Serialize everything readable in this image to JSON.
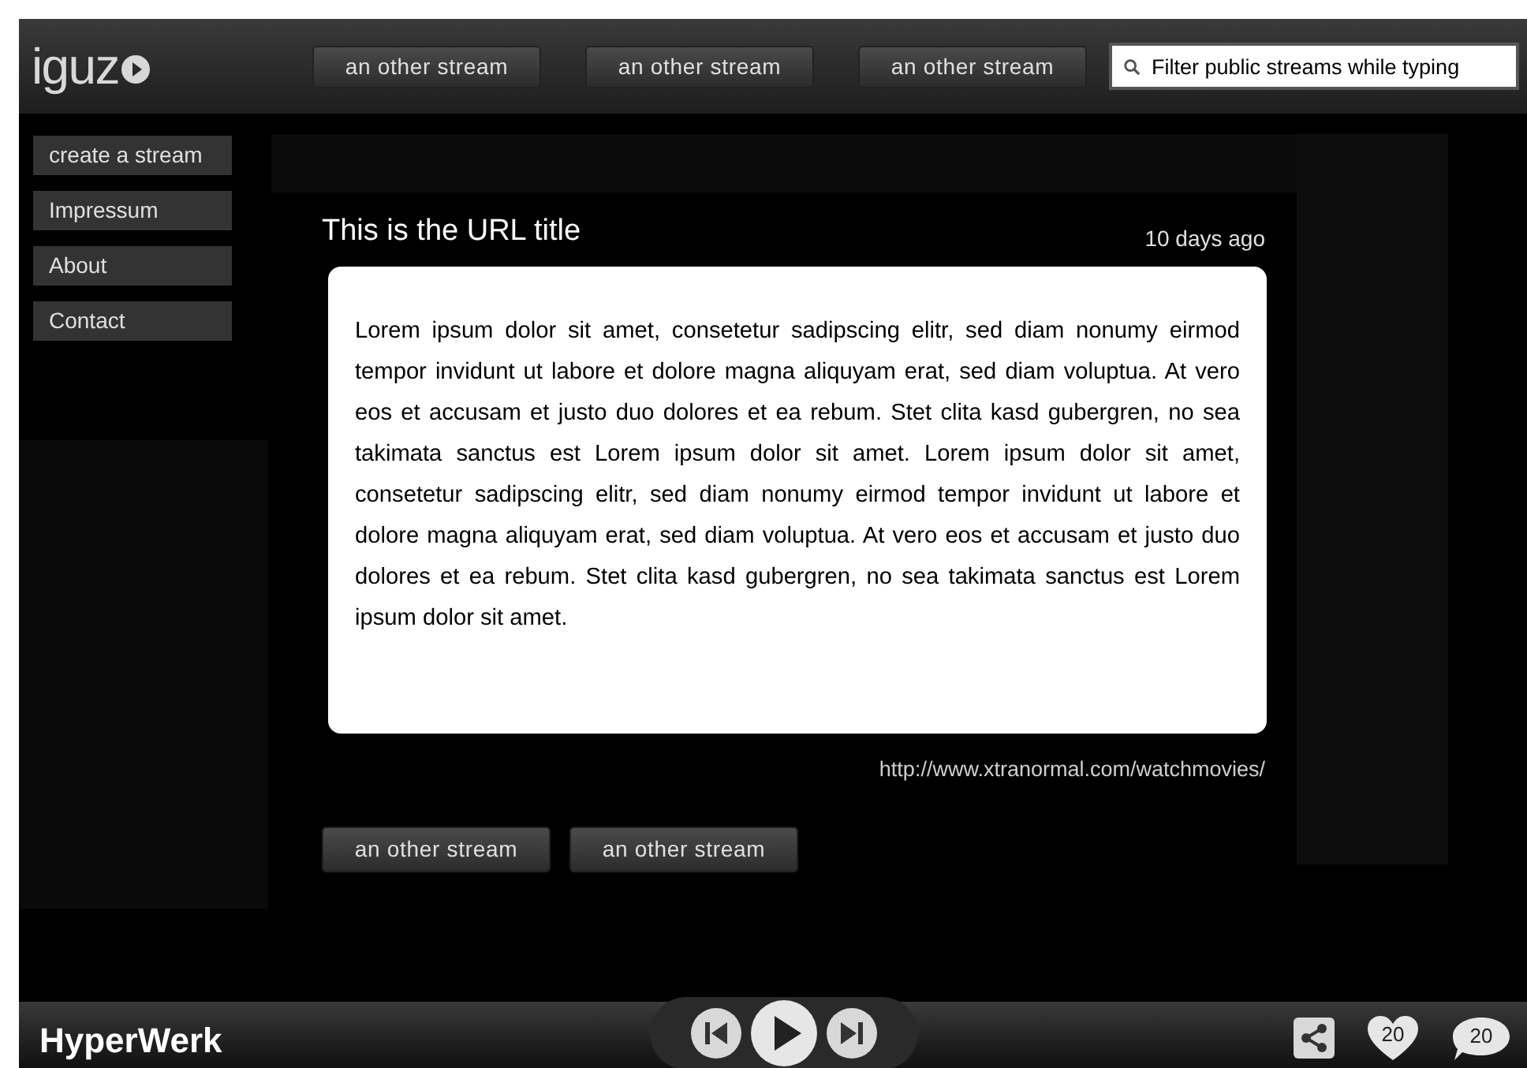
{
  "header": {
    "logo_text": "iguz",
    "stream_buttons": [
      "an other stream",
      "an other stream",
      "an other stream"
    ],
    "search": {
      "placeholder": "Filter public streams while typing"
    }
  },
  "sidebar": {
    "items": [
      "create a stream",
      "Impressum",
      "About",
      "Contact"
    ]
  },
  "post": {
    "title": "This is the URL title",
    "time": "10 days ago",
    "body": "Lorem ipsum dolor sit amet, consetetur sadipscing elitr, sed diam nonumy eirmod tempor invidunt ut labore et dolore magna aliquyam erat, sed diam voluptua. At vero eos et accusam et justo duo dolores et ea rebum. Stet clita kasd gubergren, no sea takimata sanctus est Lorem ipsum dolor sit amet. Lorem ipsum dolor sit amet, consetetur sadipscing elitr, sed diam nonumy eirmod tempor invidunt ut labore et dolore magna aliquyam erat, sed diam voluptua. At vero eos et accusam et justo duo dolores et ea rebum. Stet clita kasd gubergren, no sea takimata sanctus est Lorem ipsum dolor sit amet.",
    "url": "http://www.xtranormal.com/watchmovies/",
    "stream_buttons": [
      "an other stream",
      "an other stream"
    ]
  },
  "footer": {
    "brand": "HyperWerk",
    "likes": "20",
    "comments": "20"
  }
}
